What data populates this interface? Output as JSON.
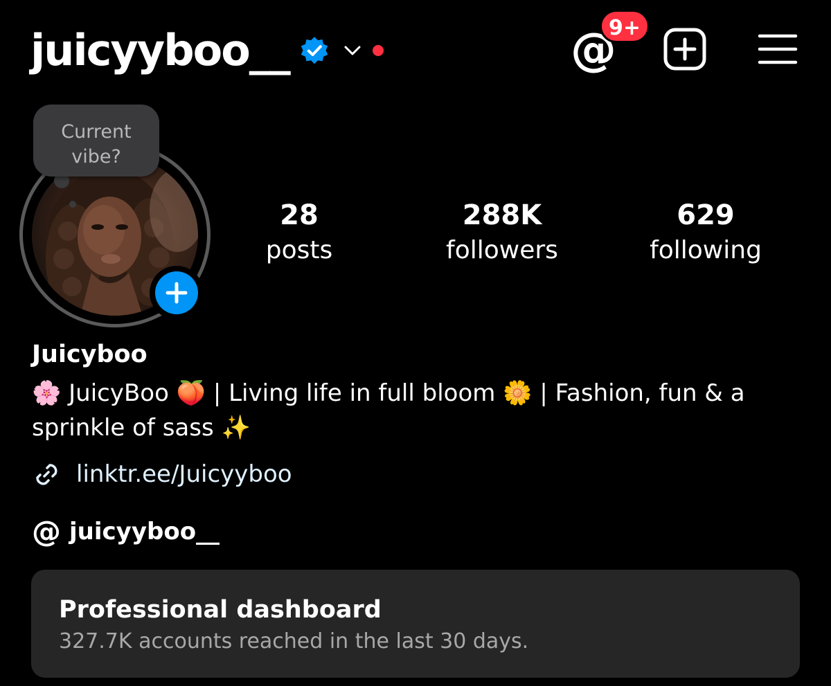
{
  "header": {
    "username": "juicyyboo__",
    "verified_icon": "verified-badge-icon",
    "dropdown_icon": "chevron-down-icon",
    "notification_dot_color": "#ff3040",
    "threads_icon": "threads-icon",
    "threads_glyph": "@",
    "threads_badge": "9+",
    "create_icon": "plus-square-icon",
    "menu_icon": "hamburger-menu-icon"
  },
  "profile": {
    "note_text": "Current\nvibe?",
    "add_story_icon": "plus-icon",
    "add_story_color": "#0095f6"
  },
  "stats": [
    {
      "value": "28",
      "label": "posts"
    },
    {
      "value": "288K",
      "label": "followers"
    },
    {
      "value": "629",
      "label": "following"
    }
  ],
  "bio": {
    "display_name": "Juicyboo",
    "text": "🌸 JuicyBoo 🍑 | Living life in full bloom 🌼 | Fashion, fun & a sprinkle of sass ✨",
    "link_icon": "link-icon",
    "link": "linktr.ee/Juicyyboo",
    "link_color": "#e0f1ff",
    "threads_icon": "threads-icon",
    "threads_glyph": "@",
    "threads_handle": "juicyyboo__"
  },
  "dashboard": {
    "title": "Professional dashboard",
    "subtitle": "327.7K accounts reached in the last 30 days."
  },
  "colors": {
    "background": "#000000",
    "card": "#262626",
    "accent_blue": "#0095f6",
    "badge_red": "#ff3040"
  }
}
